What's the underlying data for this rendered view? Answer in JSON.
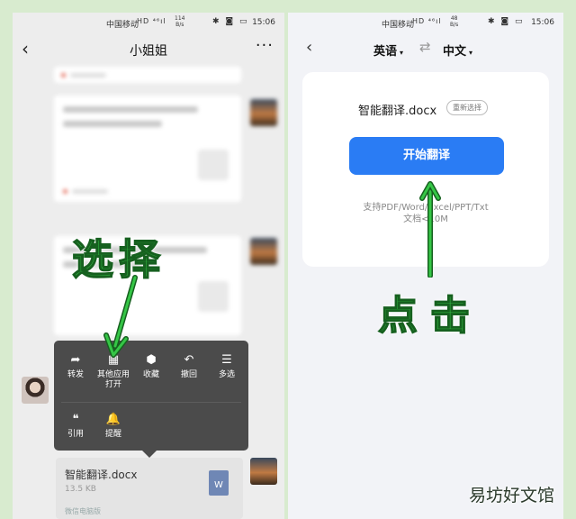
{
  "left_screen": {
    "status": {
      "carrier": "中国移动",
      "network": "HD ⁴⁶ıl",
      "speed_value": "114",
      "speed_unit": "B/s",
      "icons": "✱ ◙ ▭",
      "time": "15:06"
    },
    "header": {
      "title": "小姐姐"
    },
    "context_menu": {
      "items": [
        {
          "icon": "share-icon",
          "glyph": "➦",
          "label": "转发"
        },
        {
          "icon": "grid-icon",
          "glyph": "▦",
          "label": "其他应用\n打开"
        },
        {
          "icon": "cube-icon",
          "glyph": "⬢",
          "label": "收藏"
        },
        {
          "icon": "undo-icon",
          "glyph": "↶",
          "label": "撤回"
        },
        {
          "icon": "multiselect-icon",
          "glyph": "☰",
          "label": "多选"
        },
        {
          "icon": "quote-icon",
          "glyph": "❝",
          "label": "引用"
        },
        {
          "icon": "bell-icon",
          "glyph": "🔔",
          "label": "提醒"
        }
      ]
    },
    "file_message": {
      "name": "智能翻译.docx",
      "size": "13.5 KB",
      "badge": "W",
      "source": "微信电脑版"
    },
    "annotation": "选择"
  },
  "right_screen": {
    "status": {
      "carrier": "中国移动",
      "network": "HD ⁴⁶ıl",
      "speed_value": "48",
      "speed_unit": "B/s",
      "icons": "✱ ◙ ▭",
      "time": "15:06"
    },
    "header": {
      "source_lang": "英语",
      "target_lang": "中文"
    },
    "card": {
      "file_name": "智能翻译.docx",
      "reselect_label": "重新选择",
      "start_label": "开始翻译",
      "support_line1": "支持PDF/Word/Excel/PPT/Txt",
      "support_line2": "文档<10M"
    },
    "annotation": "点击"
  },
  "watermark": "易坊好文馆",
  "colors": {
    "accent_blue": "#2a7cf4",
    "annotation_green": "#35c646",
    "page_bg": "#d8ebcf"
  }
}
